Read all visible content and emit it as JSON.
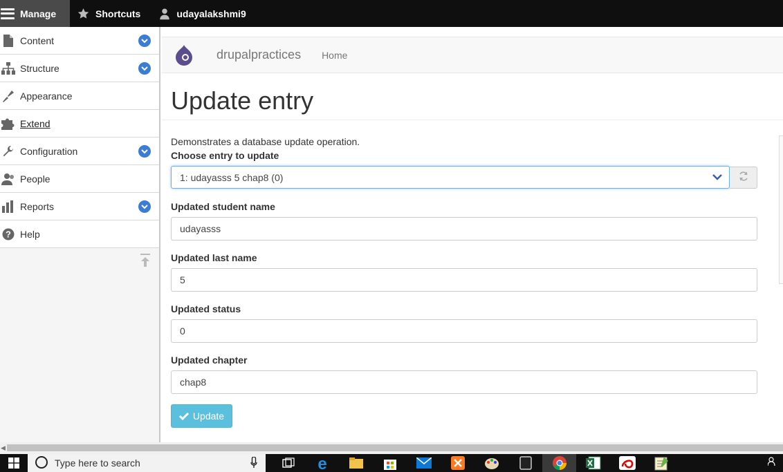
{
  "toolbar": {
    "manage_label": "Manage",
    "shortcuts_label": "Shortcuts",
    "user_label": "udayalakshmi9"
  },
  "sidebar": {
    "items": [
      {
        "label": "Content",
        "icon": "file-icon",
        "expandable": true
      },
      {
        "label": "Structure",
        "icon": "sitemap-icon",
        "expandable": true
      },
      {
        "label": "Appearance",
        "icon": "paintbrush-icon",
        "expandable": false
      },
      {
        "label": "Extend",
        "icon": "puzzle-icon",
        "expandable": false,
        "active": true
      },
      {
        "label": "Configuration",
        "icon": "wrench-icon",
        "expandable": true
      },
      {
        "label": "People",
        "icon": "people-icon",
        "expandable": false
      },
      {
        "label": "Reports",
        "icon": "bar-chart-icon",
        "expandable": true
      },
      {
        "label": "Help",
        "icon": "help-icon",
        "expandable": false
      }
    ]
  },
  "header": {
    "site_name": "drupalpractices",
    "home_link": "Home"
  },
  "page": {
    "title": "Update entry",
    "description": "Demonstrates a database update operation."
  },
  "form": {
    "entry_label": "Choose entry to update",
    "entry_value": "1: udayasss 5 chap8 (0)",
    "name_label": "Updated student name",
    "name_value": "udayasss",
    "last_name_label": "Updated last name",
    "last_name_value": "5",
    "status_label": "Updated status",
    "status_value": "0",
    "chapter_label": "Updated chapter",
    "chapter_value": "chap8",
    "submit_label": "Update"
  },
  "taskbar": {
    "search_placeholder": "Type here to search",
    "apps": [
      "task-view-icon",
      "edge-icon",
      "file-explorer-icon",
      "store-icon",
      "mail-icon",
      "xampp-icon",
      "paint-icon",
      "tablet-icon",
      "chrome-icon",
      "excel-icon",
      "airtel-icon",
      "notepad-icon"
    ]
  },
  "colors": {
    "toolbar_bg": "#0f0f0f",
    "manage_bg": "#4a4a4a",
    "accent_blue": "#3b7dd0",
    "button_info": "#5bc0de",
    "focus_border": "#66afe9"
  }
}
